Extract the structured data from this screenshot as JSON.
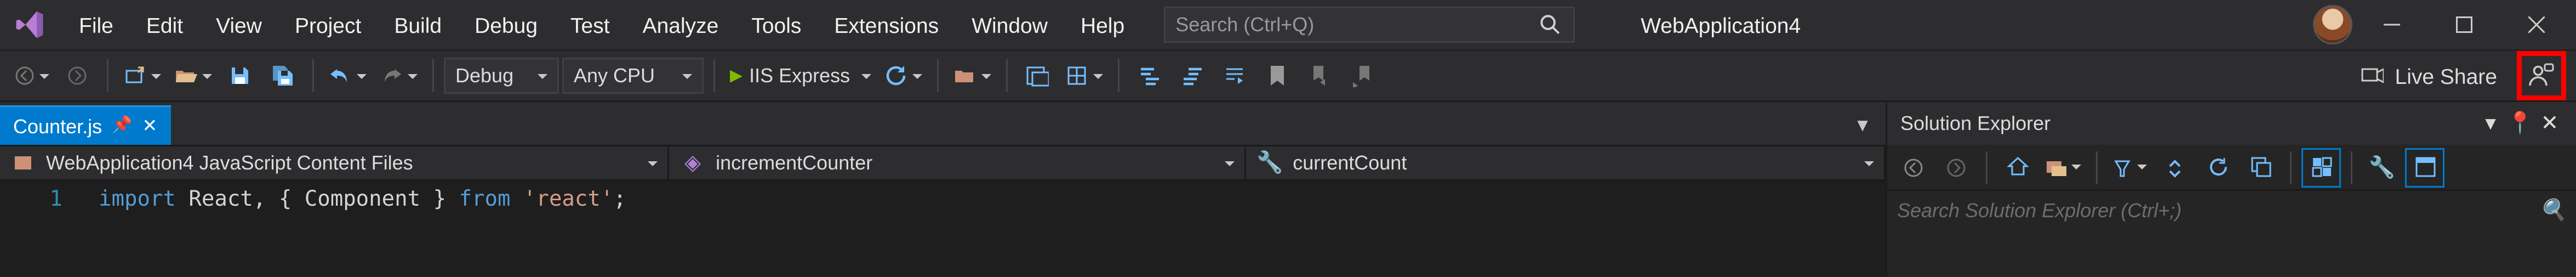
{
  "menu": {
    "items": [
      "File",
      "Edit",
      "View",
      "Project",
      "Build",
      "Debug",
      "Test",
      "Analyze",
      "Tools",
      "Extensions",
      "Window",
      "Help"
    ]
  },
  "search": {
    "placeholder": "Search (Ctrl+Q)"
  },
  "app_title": "WebApplication4",
  "toolbar": {
    "config_combo": "Debug",
    "platform_combo": "Any CPU",
    "run_target": "IIS Express",
    "live_share": "Live Share"
  },
  "editor": {
    "tab": {
      "filename": "Counter.js"
    },
    "nav": {
      "scope": "WebApplication4 JavaScript Content Files",
      "member": "incrementCounter",
      "field": "currentCount"
    },
    "line_number": "1",
    "code": {
      "kw_import": "import",
      "id_react": "React",
      "punc1": ", { ",
      "id_component": "Component",
      "punc2": " } ",
      "kw_from": "from",
      "str_react": "'react'",
      "punc3": ";"
    }
  },
  "solution_explorer": {
    "title": "Solution Explorer",
    "search_placeholder": "Search Solution Explorer (Ctrl+;)"
  }
}
